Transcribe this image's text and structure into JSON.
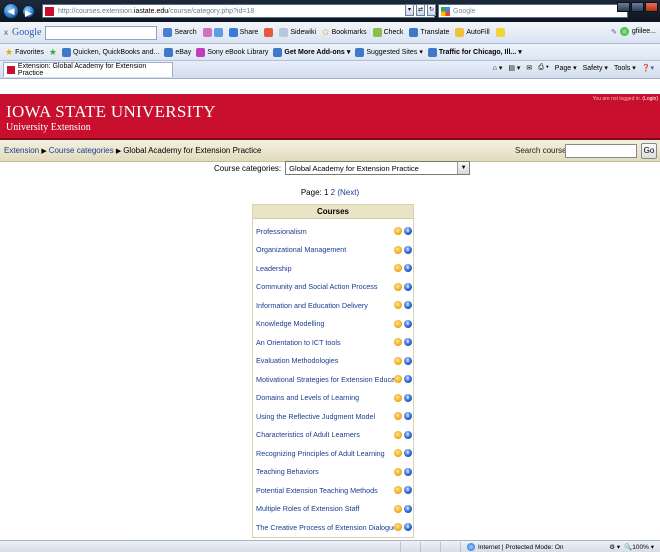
{
  "browser": {
    "url_prefix": "http://courses.extension.",
    "url_domain": "iastate.edu",
    "url_path": "/course/category.php?id=18",
    "search_engine": "Google",
    "tab_title": "Extension: Global Academy for Extension Practice"
  },
  "google_toolbar": {
    "close": "x",
    "logo": "Google",
    "items": [
      "Search",
      "Share",
      "Sidewiki",
      "Bookmarks",
      "Check",
      "Translate",
      "AutoFill"
    ],
    "user": "gfiilee..."
  },
  "favorites_bar": {
    "favorites_label": "Favorites",
    "items": [
      "Quicken, QuickBooks and...",
      "eBay",
      "Sony eBook Library",
      "Get More Add-ons",
      "Suggested Sites",
      "Traffic for Chicago, Ill..."
    ]
  },
  "command_bar": [
    "Page",
    "Safety",
    "Tools"
  ],
  "site": {
    "university": "IOWA STATE UNIVERSITY",
    "subtitle": "University Extension",
    "login_text": "You are not logged in.",
    "login_link": "(Login)"
  },
  "breadcrumb": {
    "home": "Extension",
    "categories": "Course categories",
    "current": "Global Academy for Extension Practice"
  },
  "search": {
    "label": "Search courses:",
    "button": "Go"
  },
  "category": {
    "label": "Course categories:",
    "selected": "Global Academy for Extension Practice"
  },
  "paging": {
    "label": "Page:",
    "current": "1",
    "page2": "2",
    "next": "(Next)"
  },
  "courses": {
    "header": "Courses",
    "items": [
      "Professionalism",
      "Organizational Management",
      "Leadership",
      "Community and Social Action Process",
      "Information and Education Delivery",
      "Knowledge Modelling",
      "An Orientation to ICT tools",
      "Evaluation Methodologies",
      "Motivational Strategies for Extension Educators",
      "Domains and Levels of Learning",
      "Using the Reflective Judgment Model",
      "Characteristics of Adult Learners",
      "Recognizing Principles of Adult Learning",
      "Teaching Behaviors",
      "Potential Extension Teaching Methods",
      "Multiple Roles of Extension Staff",
      "The Creative Process of Extension Dialogue"
    ]
  },
  "status": {
    "zone": "Internet | Protected Mode: On",
    "zoom": "100%"
  },
  "colors": {
    "isu_red": "#c8102e",
    "nav_tan": "#e9e4c6",
    "link_blue": "#1a3d8f"
  }
}
